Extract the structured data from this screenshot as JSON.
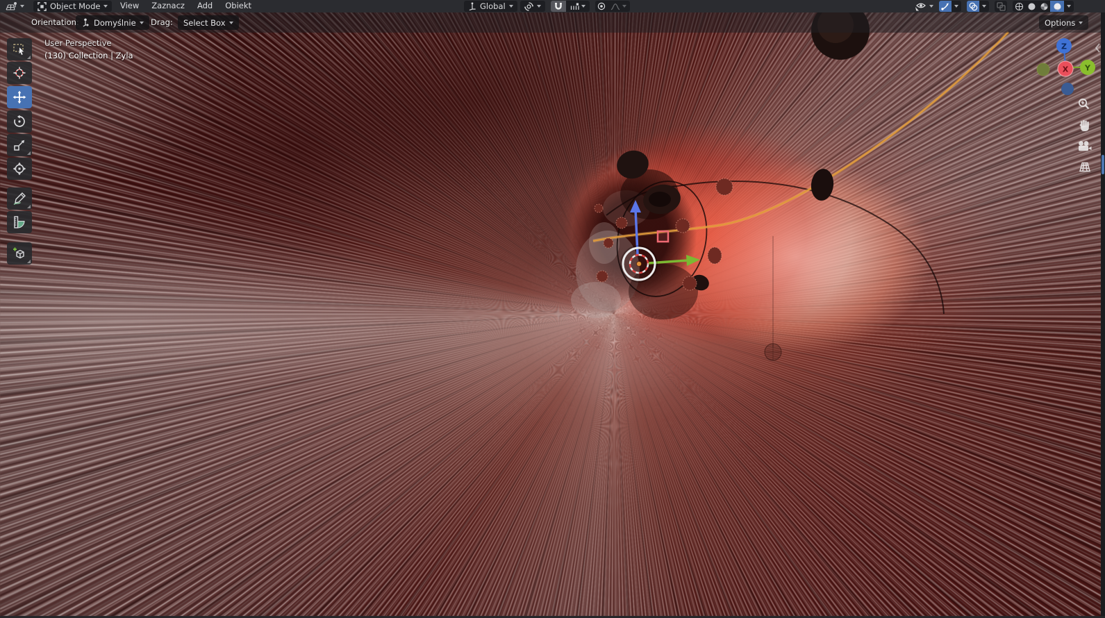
{
  "header": {
    "editor_type": "3d-viewport",
    "mode_value": "Object Mode",
    "menus": [
      "View",
      "Zaznacz",
      "Add",
      "Obiekt"
    ],
    "transform_orientation": "Global",
    "snap_enabled": true,
    "shading_modes": [
      "wireframe",
      "solid",
      "material-preview",
      "rendered"
    ],
    "active_shading": "rendered"
  },
  "tool_settings": {
    "orientation_label": "Orientation:",
    "orientation_value": "Domyślnie",
    "drag_label": "Drag:",
    "drag_value": "Select Box",
    "options_label": "Options"
  },
  "viewport": {
    "view_label": "User Perspective",
    "collection_label": "(130) Collection | Zyla",
    "axis": {
      "x": "X",
      "y": "Y",
      "z": "Z"
    }
  },
  "toolbar": {
    "tools": [
      "select-box",
      "cursor",
      "move",
      "rotate",
      "scale",
      "transform",
      "annotate",
      "measure",
      "add-cube"
    ],
    "active_tool": "move"
  },
  "nav_gizmo": {
    "balls": [
      "Z",
      "Y",
      "X",
      "-Y",
      "-Z"
    ]
  },
  "side_nav_icons": [
    "zoom",
    "pan",
    "camera-view",
    "toggle-projection"
  ],
  "colors": {
    "accent_blue": "#4772b3",
    "axis_x_red": "#ea4f5b",
    "axis_y_green": "#8abe2d",
    "axis_z_blue": "#3f72d6",
    "path_orange": "#e09a3a",
    "header_bg": "#2b2c30",
    "widget_bg": "#1d1e22",
    "viewport_dark_red": "#3a1011"
  }
}
